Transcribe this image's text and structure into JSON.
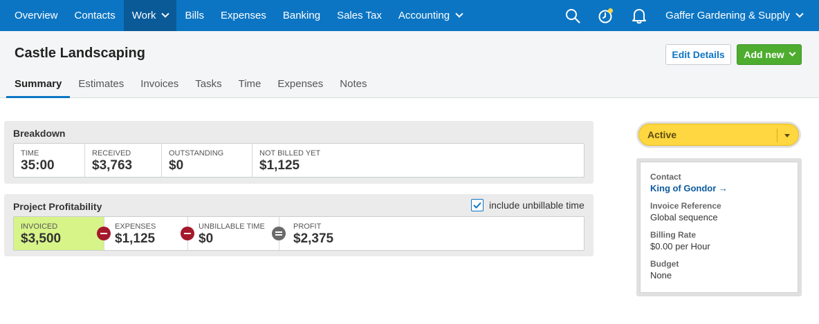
{
  "nav": {
    "items": [
      {
        "label": "Overview"
      },
      {
        "label": "Contacts"
      },
      {
        "label": "Work"
      },
      {
        "label": "Bills"
      },
      {
        "label": "Expenses"
      },
      {
        "label": "Banking"
      },
      {
        "label": "Sales Tax"
      },
      {
        "label": "Accounting"
      }
    ],
    "active": "Work",
    "org_name": "Gaffer Gardening & Supply",
    "icons": [
      "search-icon",
      "timer-icon",
      "bell-icon"
    ]
  },
  "header": {
    "title": "Castle Landscaping",
    "edit_label": "Edit Details",
    "add_label": "Add new",
    "tabs": [
      {
        "label": "Summary"
      },
      {
        "label": "Estimates"
      },
      {
        "label": "Invoices"
      },
      {
        "label": "Tasks"
      },
      {
        "label": "Time"
      },
      {
        "label": "Expenses"
      },
      {
        "label": "Notes"
      }
    ],
    "active_tab": "Summary"
  },
  "breakdown": {
    "title": "Breakdown",
    "cells": [
      {
        "label": "TIME",
        "value": "35:00"
      },
      {
        "label": "RECEIVED",
        "value": "$3,763"
      },
      {
        "label": "OUTSTANDING",
        "value": "$0"
      },
      {
        "label": "NOT BILLED YET",
        "value": "$1,125"
      }
    ]
  },
  "profitability": {
    "title": "Project Profitability",
    "checkbox_label": "include unbillable time",
    "checkbox_checked": true,
    "cells": [
      {
        "label": "INVOICED",
        "value": "$3,500"
      },
      {
        "label": "EXPENSES",
        "value": "$1,125"
      },
      {
        "label": "UNBILLABLE TIME",
        "value": "$0"
      },
      {
        "label": "PROFIT",
        "value": "$2,375"
      }
    ]
  },
  "status": {
    "label": "Active"
  },
  "details": {
    "contact_label": "Contact",
    "contact_value": "King of Gondor →",
    "invoice_ref_label": "Invoice Reference",
    "invoice_ref_value": "Global sequence",
    "billing_rate_label": "Billing Rate",
    "billing_rate_value": "$0.00 per Hour",
    "budget_label": "Budget",
    "budget_value": "None"
  },
  "colors": {
    "nav_bg": "#0c75c3",
    "nav_active": "#0a5a98",
    "add_button": "#4ead2f",
    "invoiced_bg": "#d7f489",
    "status_bg": "#ffd740",
    "minus_op": "#a4192c"
  }
}
